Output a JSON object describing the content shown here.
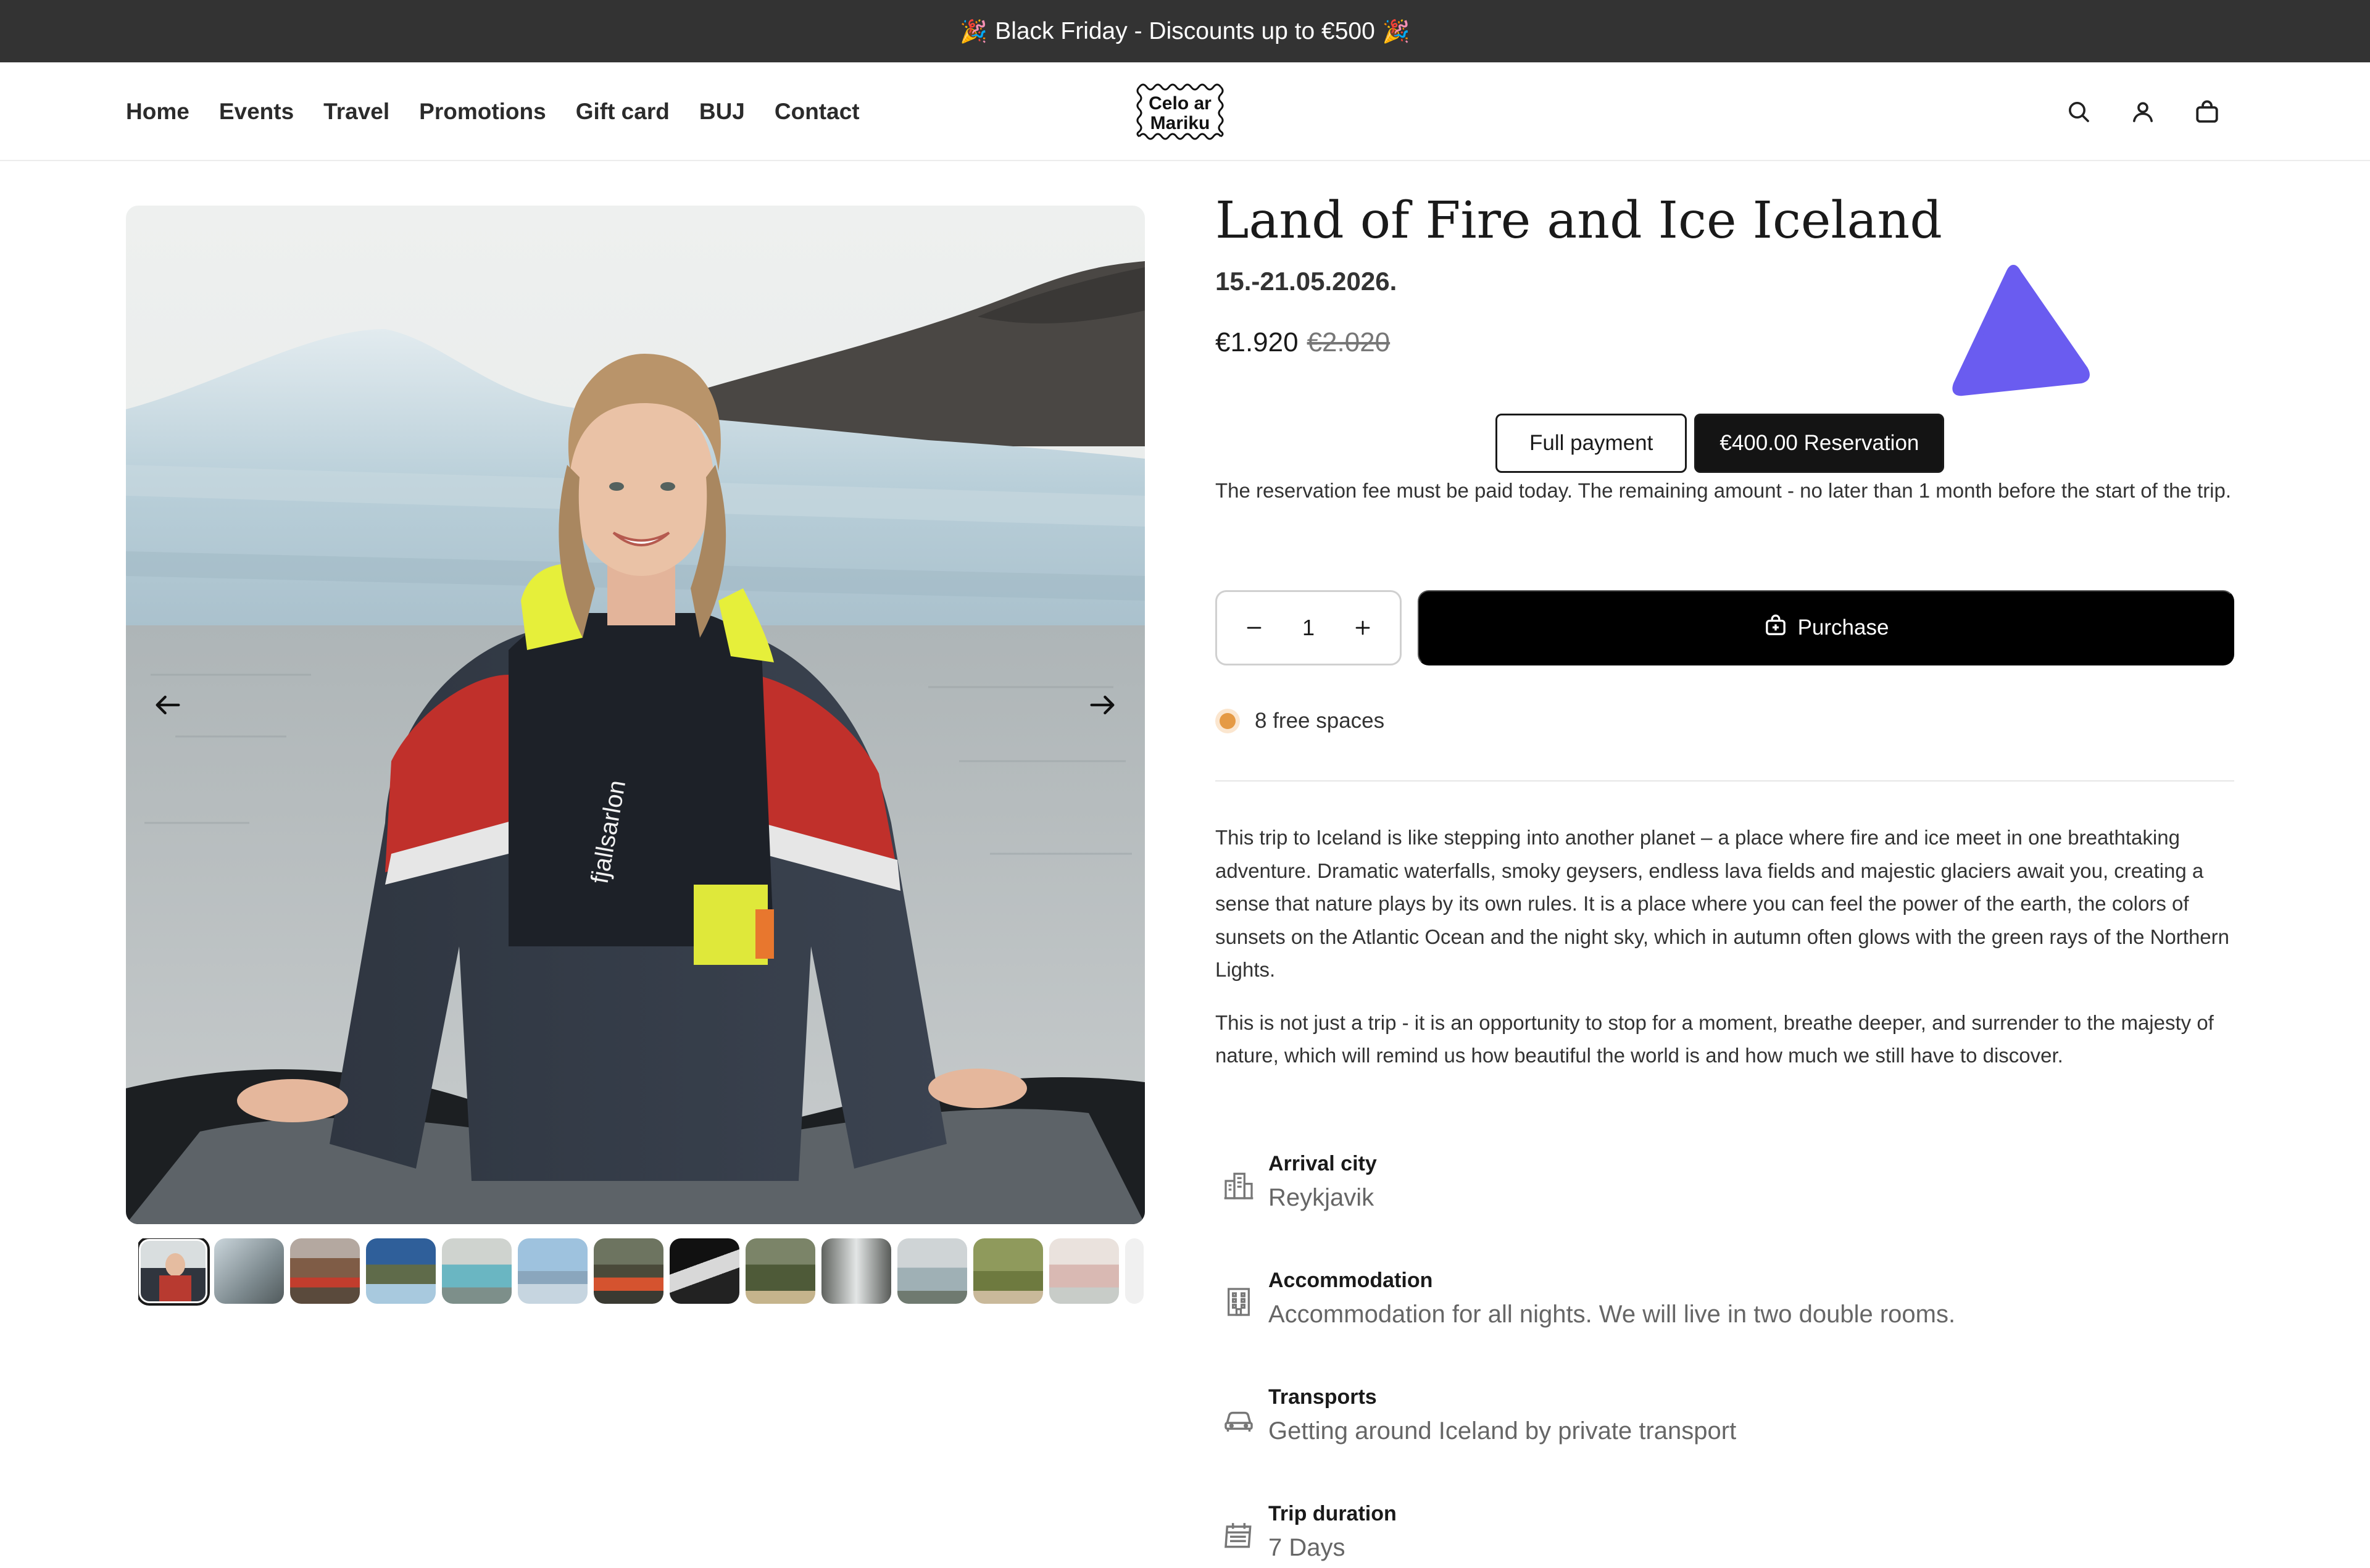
{
  "announcement": {
    "emoji_left": "🎉",
    "text": "Black Friday - Discounts up to €500",
    "emoji_right": "🎉"
  },
  "header": {
    "nav": [
      "Home",
      "Events",
      "Travel",
      "Promotions",
      "Gift card",
      "BUJ",
      "Contact"
    ],
    "logo": {
      "line1": "Celo ar",
      "line2": "Mariku"
    },
    "icons": [
      "search-icon",
      "account-icon",
      "cart-icon"
    ]
  },
  "gallery": {
    "thumbnail_count": 14,
    "active_thumbnail": 1
  },
  "product": {
    "title": "Land of Fire and Ice Iceland",
    "dates": "15.-21.05.2026.",
    "price_current": "€1.920",
    "price_old": "€2.020",
    "payment_options": [
      "Full payment",
      "€400.00 Reservation"
    ],
    "selected_payment": "€400.00 Reservation",
    "reservation_note": "The reservation fee must be paid today. The remaining amount - no later than 1 month before the start of the trip.",
    "quantity": "1",
    "purchase_label": "Purchase",
    "availability": "8 free spaces",
    "description": [
      "This trip to Iceland is like stepping into another planet – a place where fire and ice meet in one breathtaking adventure. Dramatic waterfalls, smoky geysers, endless lava fields and majestic glaciers await you, creating a sense that nature plays by its own rules. It is a place where you can feel the power of the earth, the colors of sunsets on the Atlantic Ocean and the night sky, which in autumn often glows with the green rays of the Northern Lights.",
      "This is not just a trip - it is an opportunity to stop for a moment, breathe deeper, and surrender to the majesty of nature, which will remind us how beautiful the world is and how much we still have to discover."
    ],
    "details": [
      {
        "icon": "city-icon",
        "label": "Arrival city",
        "value": "Reykjavik"
      },
      {
        "icon": "hotel-icon",
        "label": "Accommodation",
        "value": "Accommodation for all nights. We will live in two double rooms."
      },
      {
        "icon": "car-icon",
        "label": "Transports",
        "value": "Getting around Iceland by private transport"
      },
      {
        "icon": "calendar-icon",
        "label": "Trip duration",
        "value": "7 Days"
      }
    ]
  },
  "colors": {
    "announcement_bg": "#333333",
    "button_dark": "#000000",
    "availability_dot": "#e59a45",
    "cursor_accent": "#6a5cf0"
  }
}
